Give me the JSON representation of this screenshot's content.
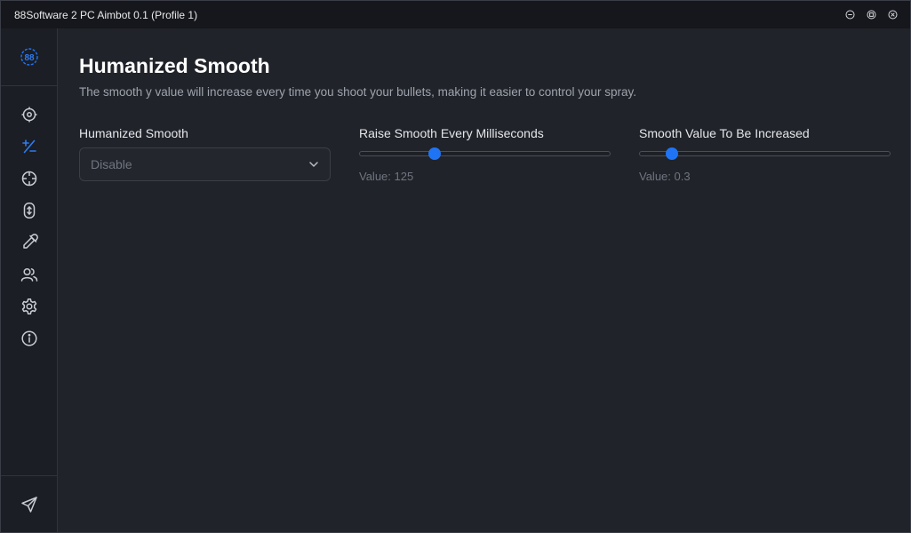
{
  "window": {
    "title": "88Software 2 PC Aimbot 0.1 (Profile 1)"
  },
  "sidebar": {
    "logo_icon": "88-logo-icon",
    "items": [
      {
        "icon": "crosshair-icon",
        "active": false
      },
      {
        "icon": "plus-minus-icon",
        "active": true
      },
      {
        "icon": "target-icon",
        "active": false
      },
      {
        "icon": "mouse-scroll-icon",
        "active": false
      },
      {
        "icon": "eyedropper-icon",
        "active": false
      },
      {
        "icon": "users-icon",
        "active": false
      },
      {
        "icon": "gear-icon",
        "active": false
      },
      {
        "icon": "info-icon",
        "active": false
      }
    ],
    "bottom_icon": "send-icon"
  },
  "main": {
    "title": "Humanized Smooth",
    "description": "The smooth y value will increase every time you shoot your bullets, making it easier to control your spray.",
    "fields": {
      "humanized_smooth": {
        "label": "Humanized Smooth",
        "value": "Disable"
      },
      "raise_every_ms": {
        "label": "Raise Smooth Every Milliseconds",
        "value_text": "Value: 125",
        "position_fraction": 0.3
      },
      "smooth_increase": {
        "label": "Smooth Value To Be Increased",
        "value_text": "Value: 0.3",
        "position_fraction": 0.13
      }
    }
  },
  "colors": {
    "accent": "#1f74f5",
    "background": "#202329",
    "sidebar": "#1b1e24",
    "titlebar": "#15171c"
  }
}
